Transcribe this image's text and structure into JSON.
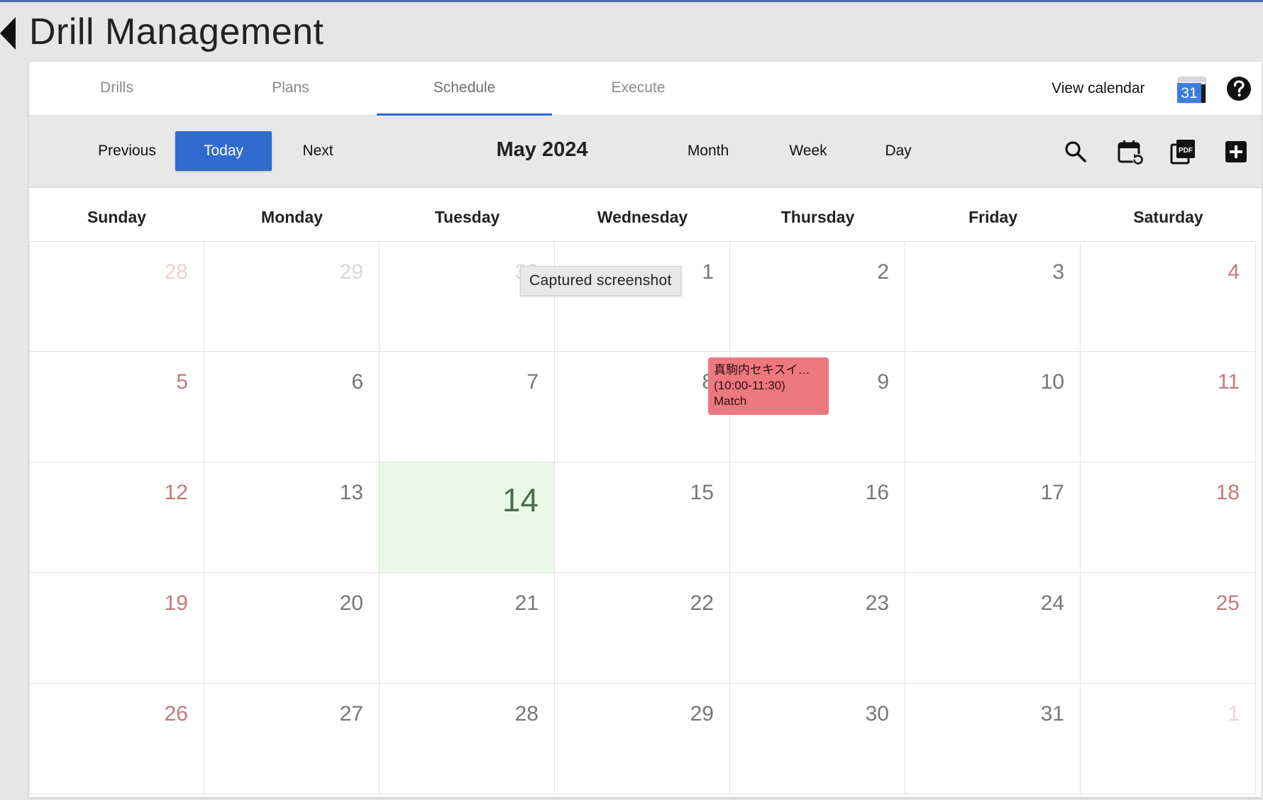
{
  "app": {
    "title": "Drill Management"
  },
  "tabs": [
    {
      "label": "Drills"
    },
    {
      "label": "Plans"
    },
    {
      "label": "Schedule",
      "active": true
    },
    {
      "label": "Execute"
    }
  ],
  "header": {
    "view_calendar_label": "View calendar",
    "gcal_icon": "google-calendar-icon",
    "gcal_number": "31",
    "help_icon": "help-icon"
  },
  "toolbar": {
    "previous_label": "Previous",
    "today_label": "Today",
    "next_label": "Next",
    "month_title": "May 2024",
    "views": [
      "Month",
      "Week",
      "Day"
    ],
    "icons": [
      "search-icon",
      "calendar-refresh-icon",
      "pdf-icon",
      "add-icon"
    ]
  },
  "weekdays": [
    "Sunday",
    "Monday",
    "Tuesday",
    "Wednesday",
    "Thursday",
    "Friday",
    "Saturday"
  ],
  "weeks": [
    [
      "28",
      "29",
      "30",
      "1",
      "2",
      "3",
      "4"
    ],
    [
      "5",
      "6",
      "7",
      "8",
      "9",
      "10",
      "11"
    ],
    [
      "12",
      "13",
      "14",
      "15",
      "16",
      "17",
      "18"
    ],
    [
      "19",
      "20",
      "21",
      "22",
      "23",
      "24",
      "25"
    ],
    [
      "26",
      "27",
      "28",
      "29",
      "30",
      "31",
      "1"
    ]
  ],
  "today_day": "14",
  "event": {
    "title": "真駒内セキスイ…",
    "time": "(10:00-11:30)",
    "type": "Match",
    "color": "#ee7880"
  },
  "tooltip": "Captured screenshot",
  "colors": {
    "accent": "#2f6bce",
    "today_bg": "#eaf8e8",
    "weekend_num": "#c27a7a"
  }
}
